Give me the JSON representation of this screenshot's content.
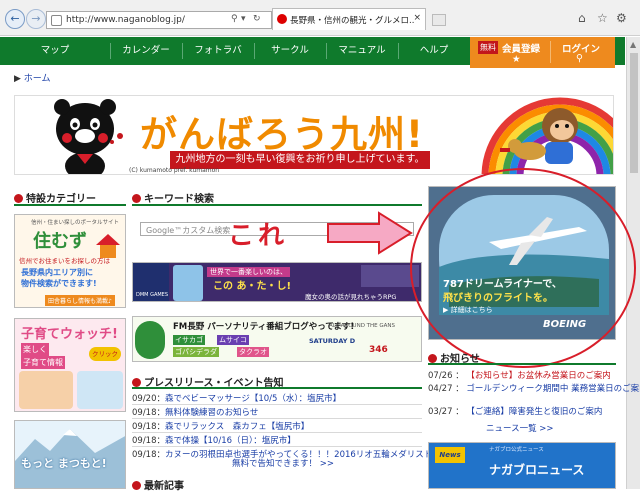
{
  "browser": {
    "url": "http://www.naganoblog.jp/",
    "tab_title": "長野県・信州の観光・グルメロ...",
    "tab_close": "×"
  },
  "menu": {
    "items": [
      "マップ",
      "カレンダー",
      "フォトラバ",
      "サークル",
      "マニュアル",
      "ヘルプ"
    ],
    "register_badge": "無料",
    "register_label": "会員登録",
    "login_label": "ログイン"
  },
  "breadcrumb": {
    "home": "ホーム"
  },
  "banner": {
    "headline": "がんばろう九州!",
    "subline": "九州地方の一刻も早い復興をお祈り申し上げています。",
    "copyright": "(C) kumamoto pref. kumamon"
  },
  "sections": {
    "special_category": "特設カテゴリー",
    "keyword_search": "キーワード検索",
    "press_release": "プレスリリース・イベント告知",
    "news_notice": "お知らせ",
    "latest_articles": "最新記事"
  },
  "search": {
    "placeholder": "カスタム検索",
    "google": "Google™"
  },
  "annotation": {
    "text": "これ"
  },
  "ads": {
    "sumuzu_top": "信州・住まい探しのポータルサイト",
    "sumuzu_logo": "住むず",
    "sumuzu_line1": "信州でお住まいをお探しの方は",
    "sumuzu_line2": "長野県内エリア別に",
    "sumuzu_line3": "物件検索ができます!",
    "sumuzu_line4": "田舎暮らし情報も満載♪",
    "kosodate_title": "子育てウォッチ!",
    "kosodate_sub1": "楽しく",
    "kosodate_sub2": "子育て情報",
    "kosodate_click": "クリック",
    "dmm_text1": "世界で一番楽しいのは、",
    "dmm_text2": "この あ・た・し!",
    "dmm_text3": "魔女の奥の話が見れちゃうRPG",
    "dmm_brand": "DMM GAMES",
    "fm_title": "FM長野 パーソナリティ番組ブログやってます!",
    "fm_p1": "イサカゴ",
    "fm_p2": "ムサイコ",
    "fm_p3": "ゴパシデラダ",
    "fm_p4": "タクラオ",
    "fm_p5": "SATURDAY D",
    "fm_p6": "346",
    "fm_p7": "ALL AROUND THE GANS",
    "plane_line1": "787ドリームライナーで、",
    "plane_line2": "飛びきりのフライトを。",
    "plane_more": "詳細はこちら",
    "plane_brand": "BOEING",
    "motto_text": "もっと まつもと!",
    "nagablo_label": "News",
    "nagablo_title": "ナガブロニュース",
    "nagablo_small": "ナガブロ公式ニュース"
  },
  "press": [
    {
      "date": "09/20",
      "title": "森でベビーマッサージ【10/5（水）：塩尻市】"
    },
    {
      "date": "09/18",
      "title": "無料体験練習のお知らせ"
    },
    {
      "date": "09/18",
      "title": "森でリラックス　森カフェ【塩尻市】"
    },
    {
      "date": "09/18",
      "title": "森で体操【10/16（日）：塩尻市】"
    },
    {
      "date": "09/18",
      "title": "カヌーの羽根田卓也選手がやってくる！！！2016リオ五輪メダリスト"
    }
  ],
  "press_more": "無料で告知できます！ >>",
  "notices": [
    {
      "date": "07/26",
      "title": "【お知らせ】お盆休み営業日のご案内",
      "red": true
    },
    {
      "date": "04/27",
      "title": "ゴールデンウィーク期間中 業務営業日のご案内",
      "red": false
    },
    {
      "date": "03/27",
      "title": "【ご連絡】障害発生と復旧のご案内",
      "red": false
    }
  ],
  "notices_more": "ニュース一覧 >>",
  "colors": {
    "menu_green": "#0f7a2c",
    "register_orange": "#ee8a1e",
    "accent_red": "#c4161c",
    "link_blue": "#1a3ea6"
  }
}
